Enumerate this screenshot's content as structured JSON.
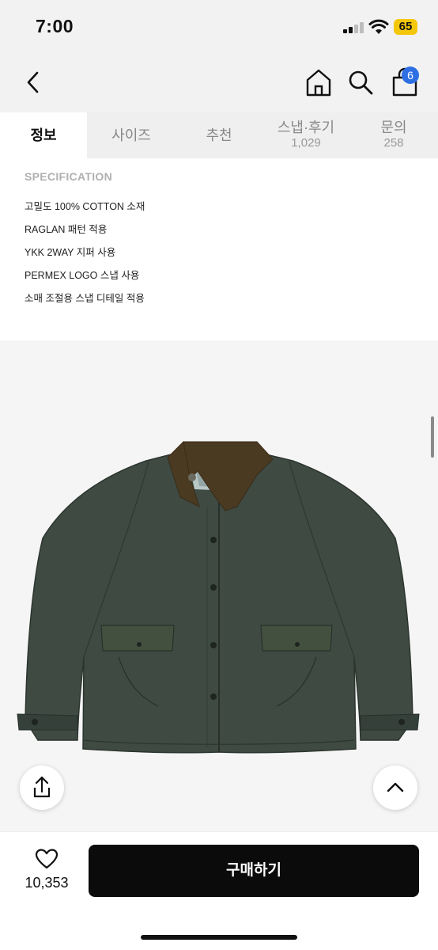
{
  "status_bar": {
    "time": "7:00",
    "battery": "65",
    "battery_color": "#f4c70a"
  },
  "nav": {
    "back_icon": "chevron-left-icon",
    "home_icon": "home-icon",
    "search_icon": "search-icon",
    "bag_icon": "shopping-bag-icon",
    "bag_badge": "6",
    "badge_color": "#2f6fe4"
  },
  "tabs": [
    {
      "label": "정보",
      "count": ""
    },
    {
      "label": "사이즈",
      "count": ""
    },
    {
      "label": "추천",
      "count": ""
    },
    {
      "label": "스냅·후기",
      "count": "1,029"
    },
    {
      "label": "문의",
      "count": "258"
    }
  ],
  "spec": {
    "title": "SPECIFICATION",
    "items": [
      "고밀도 100% COTTON 소재",
      "RAGLAN 패턴 적용",
      "YKK 2WAY 지퍼 사용",
      "PERMEX LOGO 스냅 사용",
      "소매 조절용 스냅 디테일 적용"
    ]
  },
  "product": {
    "jacket_color": "#3e4a42",
    "collar_color": "#4a3a22"
  },
  "actions": {
    "share_icon": "share-icon",
    "scroll_top_icon": "chevron-up-icon"
  },
  "bottom": {
    "like_icon": "heart-icon",
    "like_count": "10,353",
    "buy_label": "구매하기"
  }
}
